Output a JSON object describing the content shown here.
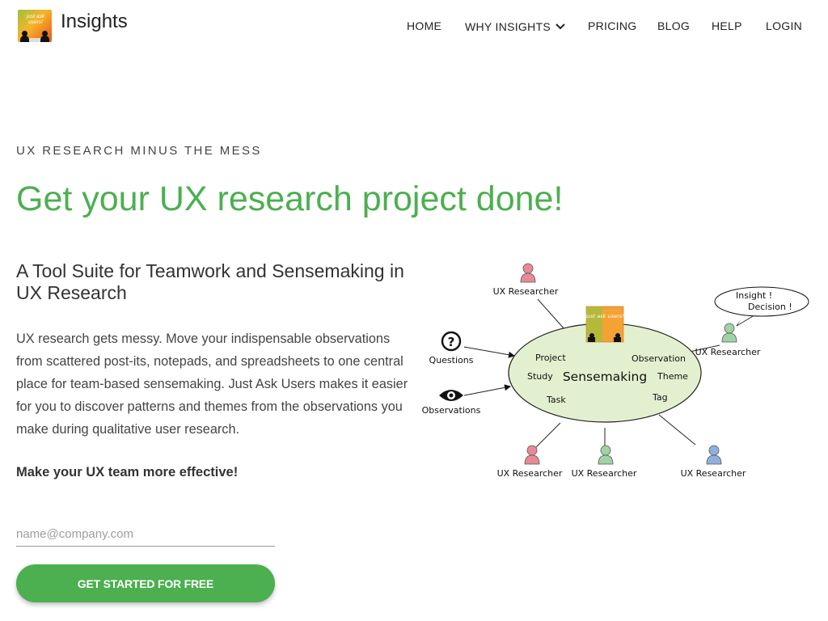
{
  "header": {
    "logo_text": "just ask users!",
    "brand": "Insights",
    "nav": {
      "home": "HOME",
      "why": "WHY INSIGHTS",
      "pricing": "PRICING",
      "blog": "BLOG",
      "help": "HELP",
      "login": "LOGIN"
    }
  },
  "hero": {
    "eyebrow": "UX RESEARCH MINUS THE MESS",
    "headline": "Get your UX research project done!",
    "subhead": "A Tool Suite for Teamwork and Sensemaking in UX Research",
    "paragraph": "UX research gets messy. Move your indispensable observations from scattered post-its, notepads, and spreadsheets to one central place for team-based sensemaking. Just Ask Users makes it easier for you to discover patterns and themes from the observations you make during qualitative user research.",
    "cta_text": "Make your UX team more effective!",
    "email_placeholder": "name@company.com",
    "button_label": "GET STARTED FOR FREE"
  },
  "diagram": {
    "center": "Sensemaking",
    "terms": {
      "project": "Project",
      "study": "Study",
      "task": "Task",
      "observation": "Observation",
      "theme": "Theme",
      "tag": "Tag"
    },
    "logo_text": "just ask users!",
    "questions": "Questions",
    "observations": "Observations",
    "speech_line1": "Insight !",
    "speech_line2": "Decision !",
    "researchers": {
      "top": "UX Researcher",
      "right": "UX Researcher",
      "bottom_left": "UX Researcher",
      "bottom_mid": "UX Researcher",
      "bottom_right": "UX Researcher"
    }
  },
  "colors": {
    "accent": "#4caf50",
    "ellipse_fill": "#e3f0d0",
    "researcher_pink": "#e88a96",
    "researcher_green": "#9fd3a6",
    "researcher_blue": "#8fb0dc"
  }
}
